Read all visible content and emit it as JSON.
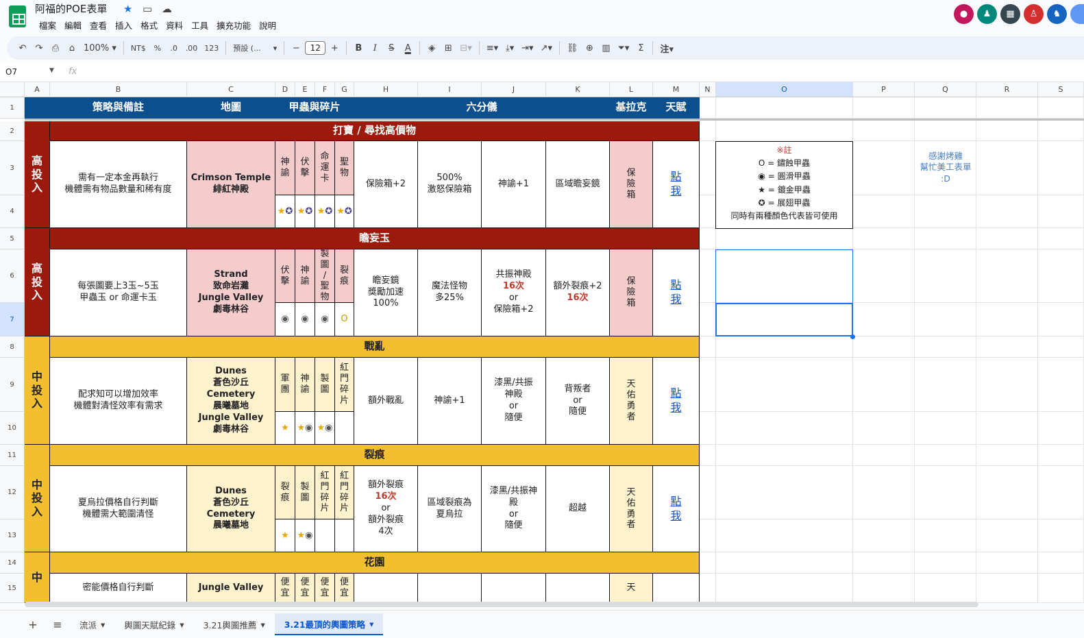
{
  "app": {
    "title": "阿福的POE表單",
    "menus": [
      "檔案",
      "編輯",
      "查看",
      "插入",
      "格式",
      "資料",
      "工具",
      "擴充功能",
      "說明"
    ]
  },
  "toolbar": {
    "zoom": "100%",
    "currency": "NT$",
    "percent": "%",
    "dec_less": ".0",
    "dec_more": ".00",
    "num_format": "123",
    "font": "預設 (...",
    "font_size": "12",
    "bold": "B",
    "italic": "I",
    "strike": "S",
    "text_color": "A",
    "sum": "Σ",
    "fx_label": "fx"
  },
  "formula": {
    "cell_ref": "O7",
    "value": ""
  },
  "columns": [
    "A",
    "B",
    "C",
    "D",
    "E",
    "F",
    "G",
    "H",
    "I",
    "J",
    "K",
    "L",
    "M",
    "N",
    "O",
    "P",
    "Q",
    "R",
    "S"
  ],
  "rows": [
    "1",
    "2",
    "3",
    "4",
    "5",
    "6",
    "7",
    "8",
    "9",
    "10",
    "11",
    "12",
    "13",
    "14",
    "15"
  ],
  "header": {
    "b": "策略與備註",
    "c": "地圖",
    "dg": "甲蟲與碎片",
    "hk": "六分儀",
    "l": "基拉克",
    "m": "天賦"
  },
  "sec1": {
    "title": "打寶 / 尋找高價物",
    "side": "高\n投\n入",
    "strategy": "需有一定本金再執行\n機體需有物品數量和稀有度",
    "map": "Crimson Temple\n緋紅神殿",
    "beetles": [
      "神\n諭",
      "伏\n擊",
      "命\n運\n卡",
      "聖\n物"
    ],
    "icons": [
      "★\n✪",
      "★\n✪",
      "★\n✪",
      "★\n✪"
    ],
    "h": "保險箱+2",
    "i": "500%\n激怒保險箱",
    "j": "神諭+1",
    "k": "區域瞻妄鏡",
    "l": "保\n險\n箱",
    "m": "點\n我"
  },
  "sec2": {
    "title": "瞻妄玉",
    "side": "高\n投\n入",
    "strategy": "每張圖要上3玉~5玉\n甲蟲玉 or 命運卡玉",
    "map": "Strand\n致命岩灘\nJungle Valley\n劇毒林谷",
    "beetles": [
      "伏\n擊",
      "神\n諭",
      "製\n圖\n/\n聖\n物",
      "裂\n痕"
    ],
    "icons": [
      "◉",
      "◉",
      "◉",
      "O"
    ],
    "h": "瞻妄鏡\n獎勵加速\n100%",
    "i": "魔法怪物\n多25%",
    "j_top": "共振神殿",
    "j_hl": "16次",
    "j_or": "or",
    "j_bot": "保險箱+2",
    "k_top": "額外裂痕+2",
    "k_hl": "16次",
    "l": "保\n險\n箱",
    "m": "點\n我"
  },
  "sec3": {
    "title": "戰亂",
    "side": "中\n投\n入",
    "strategy": "配求知可以增加效率\n機體對清怪效率有需求",
    "map": "Dunes\n蒼色沙丘\nCemetery\n晨曦墓地\nJungle Valley\n劇毒林谷",
    "beetles": [
      "軍\n團",
      "神\n諭",
      "製\n圖",
      "紅\n門\n碎\n片"
    ],
    "icons": [
      "★",
      "★\n◉",
      "★\n◉",
      ""
    ],
    "h": "額外戰亂",
    "i": "神諭+1",
    "j_top": "漆黑/共振\n神殿",
    "j_or": "or",
    "j_bot": "隨便",
    "k_top": "背叛者",
    "k_or": "or",
    "k_bot": "隨便",
    "l": "天\n佑\n勇\n者",
    "m": "點\n我"
  },
  "sec4": {
    "title": "裂痕",
    "side": "中\n投\n入",
    "strategy": "夏烏拉價格自行判斷\n機體需大範圍清怪",
    "map": "Dunes\n蒼色沙丘\nCemetery\n晨曦墓地",
    "beetles": [
      "裂\n痕",
      "製\n圖",
      "紅\n門\n碎\n片",
      "紅\n門\n碎\n片"
    ],
    "icons": [
      "★",
      "★\n◉",
      "",
      ""
    ],
    "h_top": "額外裂痕",
    "h_hl": "16次",
    "h_or": "or",
    "h_bot": "額外裂痕\n4次",
    "i": "區域裂痕為\n夏烏拉",
    "j_top": "漆黑/共振神\n殿",
    "j_or": "or",
    "j_bot": "隨便",
    "k": "超越",
    "l": "天\n佑\n勇\n者",
    "m": "點\n我"
  },
  "sec5": {
    "title": "花園",
    "side": "中",
    "strategy": "密能價格自行判斷",
    "map": "Jungle Valley",
    "beetles": [
      "便\n宜",
      "便\n宜",
      "便\n宜",
      "便\n宜"
    ],
    "l": "天"
  },
  "note": {
    "title": "※註",
    "l1": "O = 鏽蝕甲蟲",
    "l2": "◉ = 圓滑甲蟲",
    "l3": "★ = 鍍金甲蟲",
    "l4": "✪ = 展翅甲蟲",
    "l5": "同時有兩種顏色代表皆可使用"
  },
  "thanks": "感謝烤雞\n幫忙美工表單\n:D",
  "sheets": [
    "流派",
    "輿圖天賦紀錄",
    "3.21輿圖推薦",
    "3.21最頂的輿圖策略"
  ],
  "colors": {
    "header_blue": "#0b4f8f",
    "high_red": "#9b1a0b",
    "mid_yellow": "#f2bf30",
    "pink": "#f4cccc",
    "cream": "#fff2cc",
    "accent": "#0b57d0"
  }
}
